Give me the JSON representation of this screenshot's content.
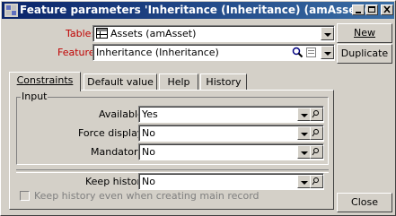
{
  "window": {
    "title": "Feature parameters 'Inheritance (Inheritance) (amAsset)'"
  },
  "form": {
    "table_label": "Table:",
    "table_value": "Assets (amAsset)",
    "feature_label": "Feature:",
    "feature_value": "Inheritance (Inheritance)"
  },
  "buttons": {
    "new": "New",
    "duplicate": "Duplicate",
    "close": "Close"
  },
  "tabs": [
    {
      "label": "Constraints",
      "active": true
    },
    {
      "label": "Default value",
      "active": false
    },
    {
      "label": "Help",
      "active": false
    },
    {
      "label": "History",
      "active": false
    }
  ],
  "constraints": {
    "group_title": "Input",
    "available_label": "Available:",
    "available_value": "Yes",
    "force_display_label": "Force display:",
    "force_display_value": "No",
    "mandatory_label": "Mandatory:",
    "mandatory_value": "No",
    "keep_history_label": "Keep history:",
    "keep_history_value": "No",
    "keep_history_main_label": "Keep history even when creating main record"
  },
  "colors": {
    "titlebar_start": "#0a246a",
    "titlebar_end": "#3a6ea5",
    "required_label": "#c00000",
    "face": "#d4d0c8"
  }
}
